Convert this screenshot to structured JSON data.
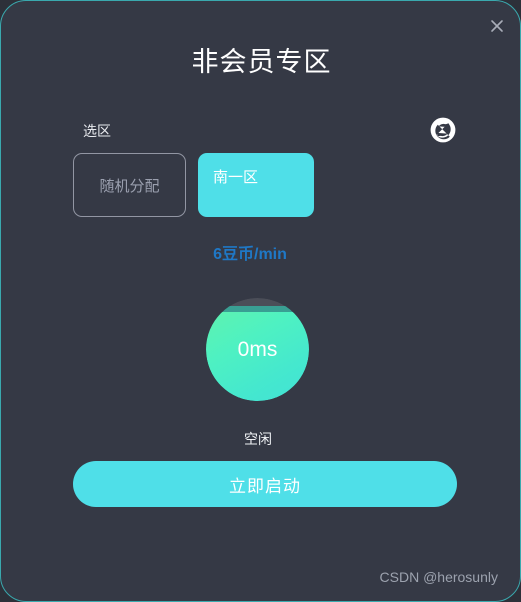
{
  "window": {
    "title": "非会员专区",
    "close_icon": "close-icon",
    "border_color": "#3aa9ae",
    "background_color": "#353945"
  },
  "region": {
    "label": "选区",
    "refresh_icon": "refresh-icon",
    "options": [
      {
        "label": "随机分配",
        "selected": false
      },
      {
        "label": "南一区",
        "selected": true
      }
    ],
    "price": "6豆币/min",
    "price_color": "#1f78c6",
    "selected_color": "#4fdfe8"
  },
  "gauge": {
    "value": "0ms",
    "fill_color": "#4ef1c2",
    "track_color": "#4b4e58"
  },
  "status": {
    "text": "空闲"
  },
  "actions": {
    "start_label": "立即启动",
    "start_color": "#4fdfe8"
  },
  "watermark": {
    "text": "CSDN @herosunly"
  }
}
